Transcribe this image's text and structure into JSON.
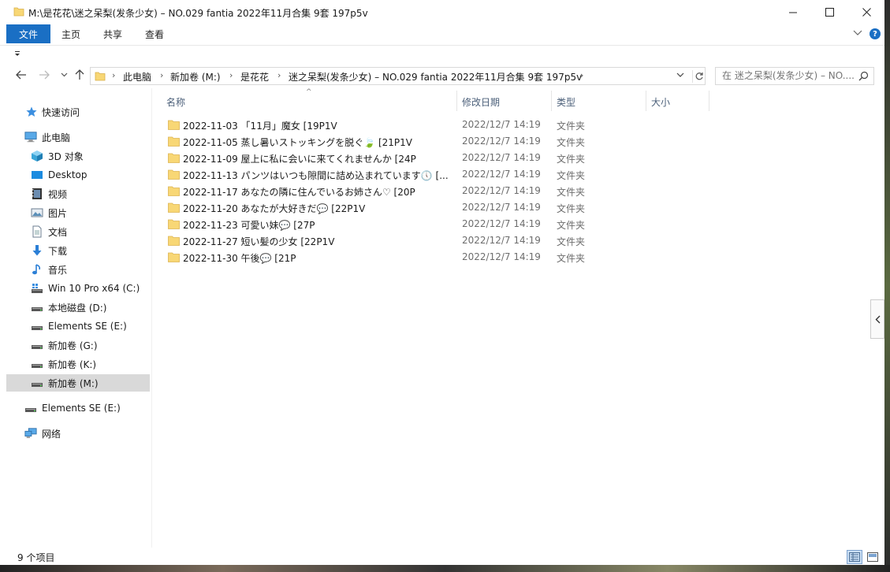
{
  "window": {
    "title": "M:\\是花花\\迷之呆梨(发条少女) – NO.029 fantia 2022年11月合集 9套 197p5v",
    "controls": [
      "minimize-icon",
      "maximize-icon",
      "close-icon"
    ]
  },
  "ribbon": {
    "file": "文件",
    "home": "主页",
    "share": "共享",
    "view": "查看"
  },
  "address": {
    "crumbs": [
      "此电脑",
      "新加卷 (M:)",
      "是花花",
      "迷之呆梨(发条少女) – NO.029 fantia 2022年11月合集 9套 197p5v"
    ]
  },
  "search": {
    "placeholder": "在 迷之呆梨(发条少女) – NO...."
  },
  "sidebar": {
    "items": [
      {
        "label": "快速访问",
        "icon": "star-icon"
      },
      {
        "label": "此电脑",
        "icon": "computer-icon"
      },
      {
        "label": "3D 对象",
        "icon": "cube-icon"
      },
      {
        "label": "Desktop",
        "icon": "desktop-icon"
      },
      {
        "label": "视频",
        "icon": "video-icon"
      },
      {
        "label": "图片",
        "icon": "picture-icon"
      },
      {
        "label": "文档",
        "icon": "document-icon"
      },
      {
        "label": "下载",
        "icon": "download-icon"
      },
      {
        "label": "音乐",
        "icon": "music-icon"
      },
      {
        "label": "Win 10 Pro x64 (C:)",
        "icon": "system-drive-icon"
      },
      {
        "label": "本地磁盘 (D:)",
        "icon": "drive-icon"
      },
      {
        "label": "Elements SE (E:)",
        "icon": "drive-icon"
      },
      {
        "label": "新加卷 (G:)",
        "icon": "drive-icon"
      },
      {
        "label": "新加卷 (K:)",
        "icon": "drive-icon"
      },
      {
        "label": "新加卷 (M:)",
        "icon": "drive-icon"
      },
      {
        "label": "Elements SE (E:)",
        "icon": "drive-icon"
      },
      {
        "label": "网络",
        "icon": "network-icon"
      }
    ]
  },
  "columns": {
    "name": "名称",
    "date": "修改日期",
    "type": "类型",
    "size": "大小"
  },
  "files": [
    {
      "name": "2022-11-03 「11月」魔女 [19P1V",
      "date": "2022/12/7 14:19",
      "type": "文件夹"
    },
    {
      "name": "2022-11-05 蒸し暑いストッキングを脱ぐ🍃 [21P1V",
      "date": "2022/12/7 14:19",
      "type": "文件夹"
    },
    {
      "name": "2022-11-09 屋上に私に会いに来てくれませんか [24P",
      "date": "2022/12/7 14:19",
      "type": "文件夹"
    },
    {
      "name": "2022-11-13 パンツはいつも隙間に詰め込まれています🕔 [...",
      "date": "2022/12/7 14:19",
      "type": "文件夹"
    },
    {
      "name": "2022-11-17 あなたの隣に住んでいるお姉さん♡ [20P",
      "date": "2022/12/7 14:19",
      "type": "文件夹"
    },
    {
      "name": "2022-11-20 あなたが大好きだ💬 [22P1V",
      "date": "2022/12/7 14:19",
      "type": "文件夹"
    },
    {
      "name": "2022-11-23 可愛い妹💬 [27P",
      "date": "2022/12/7 14:19",
      "type": "文件夹"
    },
    {
      "name": "2022-11-27 短い髪の少女 [22P1V",
      "date": "2022/12/7 14:19",
      "type": "文件夹"
    },
    {
      "name": "2022-11-30 午後💬 [21P",
      "date": "2022/12/7 14:19",
      "type": "文件夹"
    }
  ],
  "status": {
    "count": "9 个项目"
  },
  "colors": {
    "accent": "#1a6fc4",
    "folder": "#f8d775",
    "selected": "#d9d9d9",
    "header_text": "#4c607a"
  }
}
